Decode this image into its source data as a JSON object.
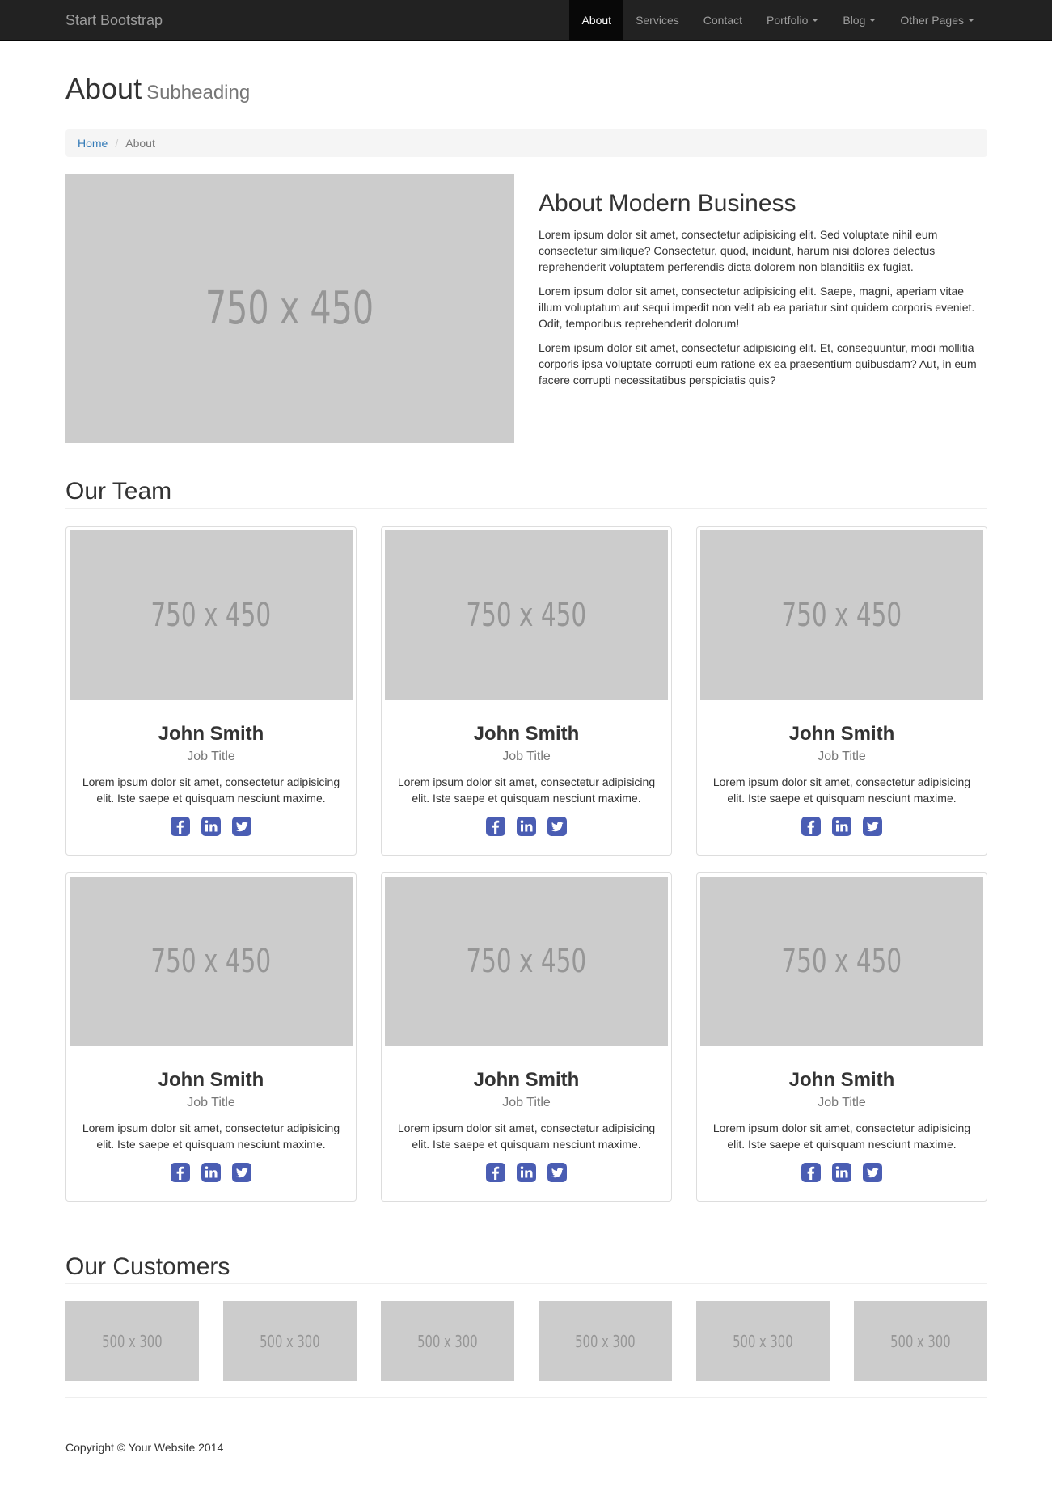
{
  "navbar": {
    "brand": "Start Bootstrap",
    "items": [
      {
        "label": "About",
        "active": true,
        "dropdown": false
      },
      {
        "label": "Services",
        "active": false,
        "dropdown": false
      },
      {
        "label": "Contact",
        "active": false,
        "dropdown": false
      },
      {
        "label": "Portfolio",
        "active": false,
        "dropdown": true
      },
      {
        "label": "Blog",
        "active": false,
        "dropdown": true
      },
      {
        "label": "Other Pages",
        "active": false,
        "dropdown": true
      }
    ]
  },
  "header": {
    "title": "About",
    "subtitle": "Subheading"
  },
  "breadcrumb": {
    "home": "Home",
    "current": "About"
  },
  "about": {
    "image_label": "750 x 450",
    "heading": "About Modern Business",
    "paragraphs": [
      "Lorem ipsum dolor sit amet, consectetur adipisicing elit. Sed voluptate nihil eum consectetur similique? Consectetur, quod, incidunt, harum nisi dolores delectus reprehenderit voluptatem perferendis dicta dolorem non blanditiis ex fugiat.",
      "Lorem ipsum dolor sit amet, consectetur adipisicing elit. Saepe, magni, aperiam vitae illum voluptatum aut sequi impedit non velit ab ea pariatur sint quidem corporis eveniet. Odit, temporibus reprehenderit dolorum!",
      "Lorem ipsum dolor sit amet, consectetur adipisicing elit. Et, consequuntur, modi mollitia corporis ipsa voluptate corrupti eum ratione ex ea praesentium quibusdam? Aut, in eum facere corrupti necessitatibus perspiciatis quis?"
    ]
  },
  "team": {
    "title": "Our Team",
    "members": [
      {
        "image_label": "750 x 450",
        "name": "John Smith",
        "role": "Job Title",
        "bio": "Lorem ipsum dolor sit amet, consectetur adipisicing elit. Iste saepe et quisquam nesciunt maxime."
      },
      {
        "image_label": "750 x 450",
        "name": "John Smith",
        "role": "Job Title",
        "bio": "Lorem ipsum dolor sit amet, consectetur adipisicing elit. Iste saepe et quisquam nesciunt maxime."
      },
      {
        "image_label": "750 x 450",
        "name": "John Smith",
        "role": "Job Title",
        "bio": "Lorem ipsum dolor sit amet, consectetur adipisicing elit. Iste saepe et quisquam nesciunt maxime."
      },
      {
        "image_label": "750 x 450",
        "name": "John Smith",
        "role": "Job Title",
        "bio": "Lorem ipsum dolor sit amet, consectetur adipisicing elit. Iste saepe et quisquam nesciunt maxime."
      },
      {
        "image_label": "750 x 450",
        "name": "John Smith",
        "role": "Job Title",
        "bio": "Lorem ipsum dolor sit amet, consectetur adipisicing elit. Iste saepe et quisquam nesciunt maxime."
      },
      {
        "image_label": "750 x 450",
        "name": "John Smith",
        "role": "Job Title",
        "bio": "Lorem ipsum dolor sit amet, consectetur adipisicing elit. Iste saepe et quisquam nesciunt maxime."
      }
    ],
    "social_icons": [
      "facebook-icon",
      "linkedin-icon",
      "twitter-icon"
    ]
  },
  "customers": {
    "title": "Our Customers",
    "logos": [
      "500 x 300",
      "500 x 300",
      "500 x 300",
      "500 x 300",
      "500 x 300",
      "500 x 300"
    ]
  },
  "footer": {
    "copyright": "Copyright © Your Website 2014"
  },
  "colors": {
    "navbar_bg": "#222222",
    "nav_active_bg": "#080808",
    "link": "#337ab7",
    "social_icon": "#4a5db3",
    "placeholder_bg": "#cccccc",
    "placeholder_text": "#969696"
  }
}
